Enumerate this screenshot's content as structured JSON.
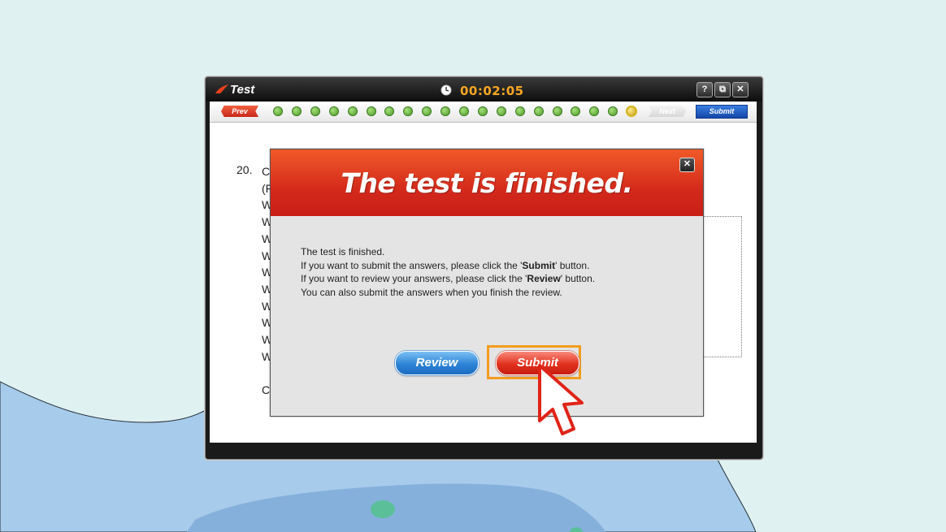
{
  "window": {
    "title": "Test",
    "timer": "00:02:05",
    "buttons": [
      "?",
      "⧉",
      "✕"
    ]
  },
  "nav": {
    "prev_label": "Prev",
    "next_label": "Next",
    "submit_label": "Submit",
    "question_count": 20,
    "current_question": 20
  },
  "question": {
    "number": "20.",
    "letters": [
      "C",
      "(F",
      "W",
      "W",
      "W",
      "W",
      "W",
      "W",
      "W",
      "W",
      "W",
      "W",
      "",
      "C"
    ]
  },
  "dialog": {
    "title": "The test is finished.",
    "close_label": "✕",
    "line1": "The test is finished.",
    "line2_pre": "If you want to submit the answers, please click the '",
    "line2_bold": "Submit",
    "line2_post": "' button.",
    "line3_pre": "If you want to review your answers, please click the '",
    "line3_bold": "Review",
    "line3_post": "' button.",
    "line4": "You can also submit the answers when you finish the review.",
    "review_label": "Review",
    "submit_label": "Submit"
  },
  "colors": {
    "accent_orange": "#f39c1f",
    "header_red": "#d42a1c",
    "progress_green": "#6cbf3a",
    "current_dot": "#e0c030"
  },
  "icons": {
    "app": "flame-logo-icon",
    "timer": "clock-icon",
    "cursor": "pointer-arrow-icon"
  }
}
